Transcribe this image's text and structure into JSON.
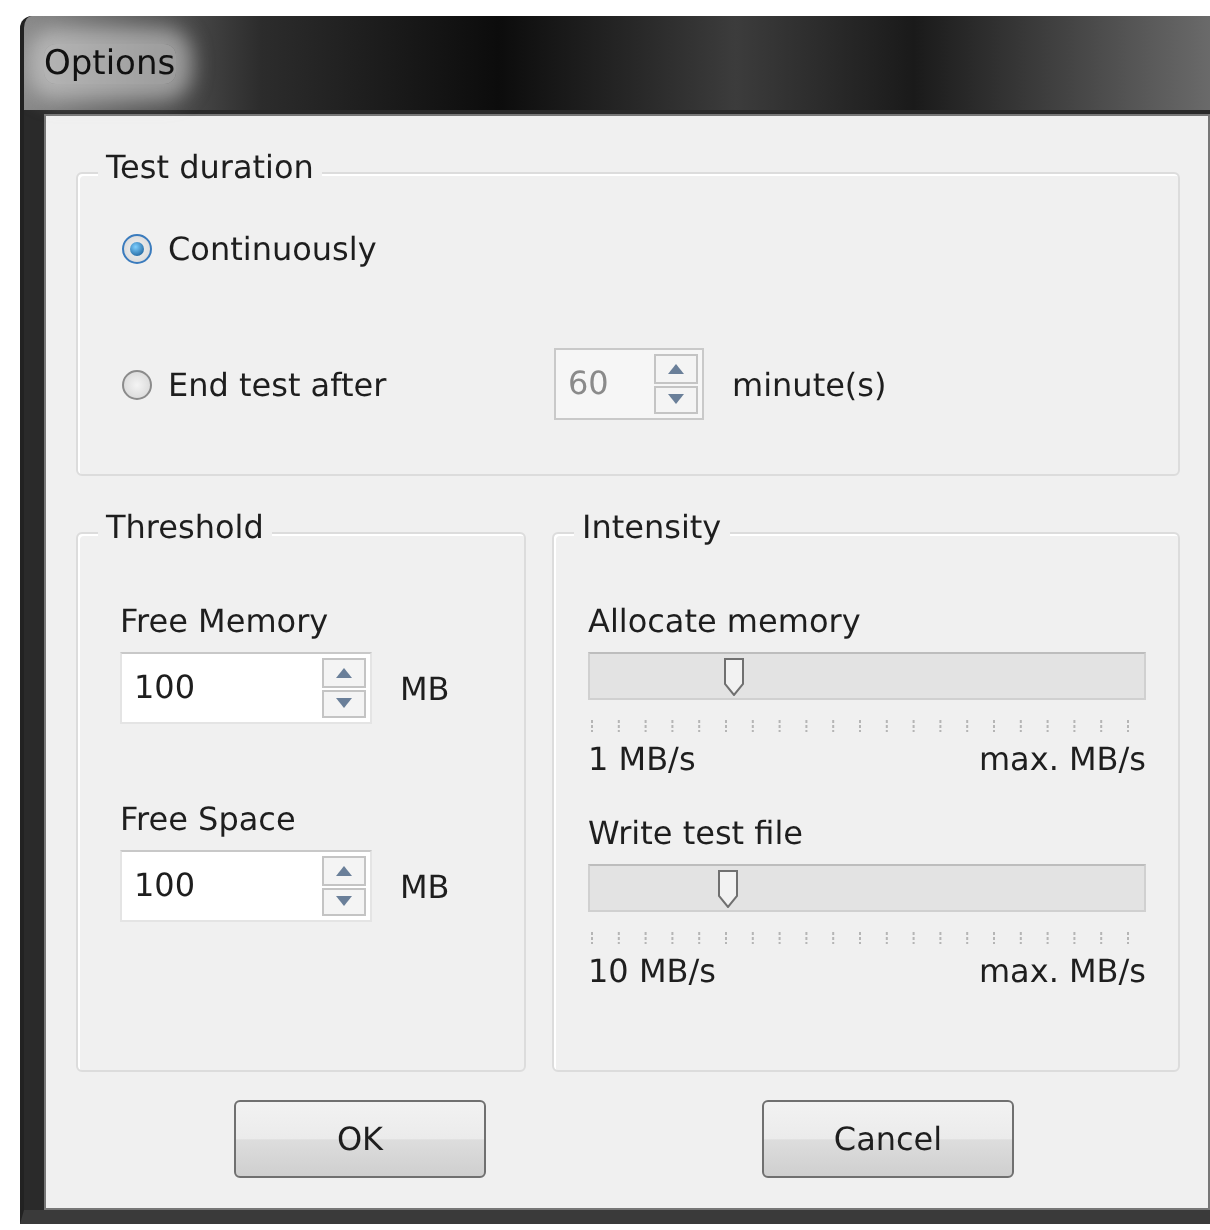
{
  "window": {
    "title": "Options"
  },
  "test_duration": {
    "title": "Test duration",
    "options": [
      {
        "label": "Continuously",
        "selected": true
      },
      {
        "label": "End test after",
        "selected": false
      }
    ],
    "duration": {
      "value": "60",
      "disabled": true,
      "unit": "minute(s)"
    }
  },
  "threshold": {
    "title": "Threshold",
    "fields": [
      {
        "label": "Free Memory",
        "value": "100",
        "disabled": false,
        "unit": "MB"
      },
      {
        "label": "Free Space",
        "value": "100",
        "disabled": false,
        "unit": "MB"
      }
    ]
  },
  "intensity": {
    "title": "Intensity",
    "sliders": [
      {
        "label": "Allocate memory",
        "level": 0.26,
        "min_label": "1 MB/s",
        "max_label": "max. MB/s"
      },
      {
        "label": "Write test file",
        "level": 0.25,
        "min_label": "10 MB/s",
        "max_label": "max. MB/s"
      }
    ]
  },
  "buttons": [
    "OK",
    "Cancel"
  ]
}
